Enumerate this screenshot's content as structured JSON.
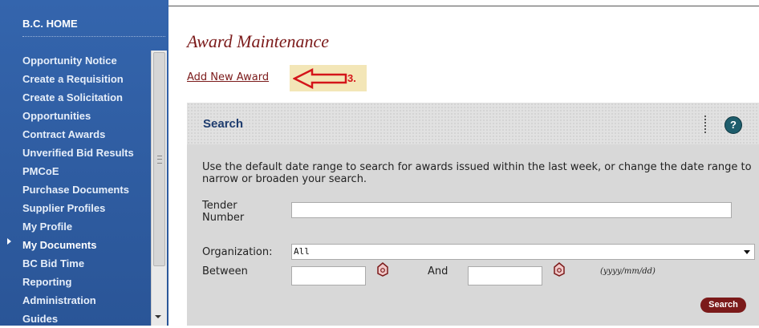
{
  "sidebar": {
    "home": "B.C. HOME",
    "items": [
      {
        "label": "Opportunity Notice"
      },
      {
        "label": "Create a Requisition"
      },
      {
        "label": "Create a Solicitation"
      },
      {
        "label": "Opportunities"
      },
      {
        "label": "Contract Awards"
      },
      {
        "label": "Unverified Bid Results"
      },
      {
        "label": "PMCoE"
      },
      {
        "label": "Purchase Documents"
      },
      {
        "label": "Supplier Profiles"
      },
      {
        "label": "My Profile"
      },
      {
        "label": "My Documents"
      },
      {
        "label": "BC Bid Time"
      },
      {
        "label": "Reporting"
      },
      {
        "label": "Administration"
      },
      {
        "label": "Guides"
      }
    ],
    "active_item": "My Documents"
  },
  "main": {
    "title": "Award Maintenance",
    "add_link": "Add New Award",
    "callout_label": "3.",
    "callout_color": "#d4151a"
  },
  "search_panel": {
    "title": "Search",
    "help_icon": "?",
    "instructions": "Use the default date range to search for awards issued within the last week, or change the date range to narrow or broaden your search.",
    "tender_label": "Tender Number",
    "tender_value": "",
    "organization_label": "Organization:",
    "organization_value": "All",
    "between_label": "Between",
    "and_label": "And",
    "date_from": "",
    "date_to": "",
    "date_format": "(yyyy/mm/dd)",
    "search_button": "Search"
  },
  "colors": {
    "sidebar_bg": "#2c5aa0",
    "title": "#7b1a1a",
    "button": "#7b1a1a",
    "panel_bg": "#d8d8d8"
  },
  "icons": [
    "help-icon",
    "calendar-icon",
    "chevron-down-icon",
    "arrow-left-icon"
  ]
}
